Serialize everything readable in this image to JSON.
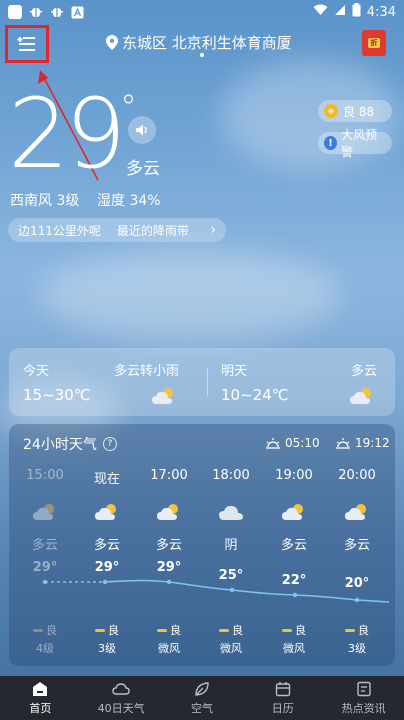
{
  "status_bar": {
    "time": "4:34",
    "left_icons": [
      "app-square-icon",
      "bug-icon",
      "bug-icon",
      "A-icon"
    ]
  },
  "header": {
    "location": "东城区 北京利生体育商厦",
    "redpack_label": "折"
  },
  "current": {
    "temperature": "29",
    "degree": "°",
    "condition": "多云",
    "wind": "西南风 3级",
    "humidity": "湿度 34%",
    "ticker_text_1": "边111公里外呢",
    "ticker_text_2": "最近的降雨带",
    "aqi": "良 88",
    "warning": "大风预警"
  },
  "forecast": {
    "today": {
      "label": "今天",
      "condition": "多云转小雨",
      "range": "15~30℃"
    },
    "tomorrow": {
      "label": "明天",
      "condition": "多云",
      "range": "10~24℃"
    }
  },
  "hourly": {
    "title": "24小时天气",
    "sunrise": "05:10",
    "sunset": "19:12",
    "hours": [
      {
        "time": "15:00",
        "condition": "多云",
        "temp": "29°",
        "aqi": "良",
        "wind": "4级",
        "past": true
      },
      {
        "time": "现在",
        "condition": "多云",
        "temp": "29°",
        "aqi": "良",
        "wind": "3级",
        "past": false
      },
      {
        "time": "17:00",
        "condition": "多云",
        "temp": "29°",
        "aqi": "良",
        "wind": "微风",
        "past": false
      },
      {
        "time": "18:00",
        "condition": "阴",
        "temp": "25°",
        "aqi": "良",
        "wind": "微风",
        "past": false
      },
      {
        "time": "19:00",
        "condition": "多云",
        "temp": "22°",
        "aqi": "良",
        "wind": "微风",
        "past": false
      },
      {
        "time": "20:00",
        "condition": "多云",
        "temp": "20°",
        "aqi": "良",
        "wind": "3级",
        "past": false
      }
    ]
  },
  "nav": [
    {
      "label": "首页",
      "icon": "home-icon",
      "active": true
    },
    {
      "label": "40日天气",
      "icon": "cloud-icon",
      "active": false
    },
    {
      "label": "空气",
      "icon": "leaf-icon",
      "active": false
    },
    {
      "label": "日历",
      "icon": "calendar-icon",
      "active": false
    },
    {
      "label": "热点资讯",
      "icon": "news-icon",
      "active": false
    }
  ],
  "colors": {
    "highlight_box": "#e0262c",
    "aqi_yellow": "#f2b926",
    "warn_blue": "#3b7de0",
    "nav_bg": "#252830"
  }
}
